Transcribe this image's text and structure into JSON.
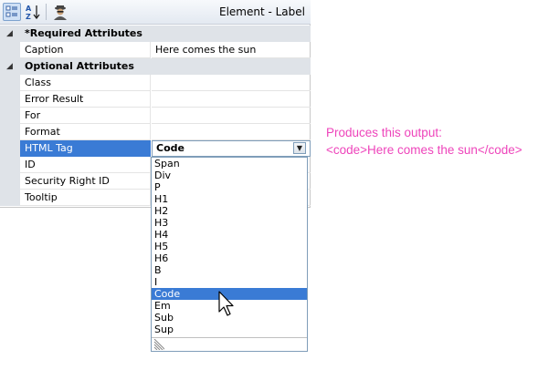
{
  "panel": {
    "title": "Element - Label",
    "toolbar": {
      "categorized_icon": "categorized-view-icon",
      "alphabetical_icon": "sort-az-icon",
      "extra_icon": "spy-agent-icon"
    }
  },
  "categories": [
    {
      "label": "*Required Attributes",
      "properties": [
        {
          "name": "Caption",
          "value": "Here comes the sun"
        }
      ]
    },
    {
      "label": "Optional Attributes",
      "properties": [
        {
          "name": "Class",
          "value": ""
        },
        {
          "name": "Error Result",
          "value": ""
        },
        {
          "name": "For",
          "value": ""
        },
        {
          "name": "Format",
          "value": ""
        },
        {
          "name": "HTML Tag",
          "value": "Code"
        },
        {
          "name": "ID",
          "value": ""
        },
        {
          "name": "Security Right ID",
          "value": ""
        },
        {
          "name": "Tooltip",
          "value": ""
        }
      ]
    }
  ],
  "dropdown": {
    "options": [
      "Span",
      "Div",
      "P",
      "H1",
      "H2",
      "H3",
      "H4",
      "H5",
      "H6",
      "B",
      "I",
      "Code",
      "Em",
      "Sub",
      "Sup"
    ],
    "highlighted": "Code"
  },
  "output": {
    "line1": "Produces this output:",
    "line2": "<code>Here comes the sun</code>"
  },
  "colors": {
    "selection": "#3a7bd5",
    "output_text": "#ee44bb",
    "category_bg": "#dfe3e8"
  }
}
